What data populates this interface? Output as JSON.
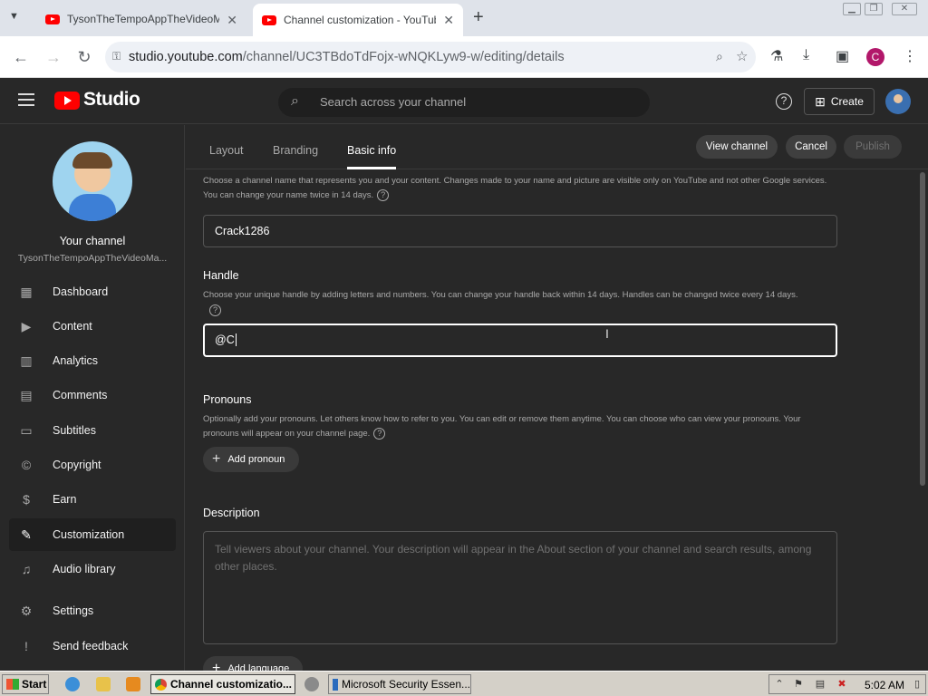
{
  "browser": {
    "tabs": [
      {
        "title": "TysonTheTempoAppTheVideoMake",
        "active": false
      },
      {
        "title": "Channel customization - YouTube S",
        "active": true
      }
    ],
    "new_tab": "+",
    "url_host": "studio.youtube.com",
    "url_path": "/channel/UC3TBdoTdFojx-wNQKLyw9-w/editing/details",
    "profile_initial": "C"
  },
  "studio": {
    "logo_text": "Studio",
    "search_placeholder": "Search across your channel",
    "create_label": "Create"
  },
  "sidebar": {
    "your_channel": "Your channel",
    "channel_name": "TysonTheTempoAppTheVideoMa...",
    "items": [
      {
        "label": "Dashboard",
        "icon": "dashboard-icon"
      },
      {
        "label": "Content",
        "icon": "content-icon"
      },
      {
        "label": "Analytics",
        "icon": "analytics-icon"
      },
      {
        "label": "Comments",
        "icon": "comments-icon"
      },
      {
        "label": "Subtitles",
        "icon": "subtitles-icon"
      },
      {
        "label": "Copyright",
        "icon": "copyright-icon"
      },
      {
        "label": "Earn",
        "icon": "earn-icon"
      },
      {
        "label": "Customization",
        "icon": "customization-icon",
        "active": true
      },
      {
        "label": "Audio library",
        "icon": "audio-library-icon"
      },
      {
        "label": "Settings",
        "icon": "settings-icon"
      },
      {
        "label": "Send feedback",
        "icon": "feedback-icon"
      }
    ]
  },
  "main": {
    "tabs": [
      {
        "label": "Layout"
      },
      {
        "label": "Branding"
      },
      {
        "label": "Basic info",
        "active": true
      }
    ],
    "view_channel": "View channel",
    "cancel": "Cancel",
    "publish": "Publish",
    "name_desc": "Choose a channel name that represents you and your content. Changes made to your name and picture are visible only on YouTube and not other Google services. You can change your name twice in 14 days.",
    "name_value": "Crack1286",
    "handle_label": "Handle",
    "handle_desc": "Choose your unique handle by adding letters and numbers. You can change your handle back within 14 days. Handles can be changed twice every 14 days.",
    "handle_value": "@C",
    "pronouns_label": "Pronouns",
    "pronouns_desc": "Optionally add your pronouns. Let others know how to refer to you. You can edit or remove them anytime. You can choose who can view your pronouns. Your pronouns will appear on your channel page.",
    "add_pronoun": "Add pronoun",
    "description_label": "Description",
    "description_placeholder": "Tell viewers about your channel. Your description will appear in the About section of your channel and search results, among other places.",
    "add_language": "Add language"
  },
  "taskbar": {
    "start": "Start",
    "items": [
      {
        "label": "Channel customizatio...",
        "active": true
      },
      {
        "label": "Microsoft Security Essen...",
        "active": false
      }
    ],
    "clock": "5:02 AM"
  },
  "colors": {
    "youtube_red": "#ff0000",
    "studio_bg": "#282828",
    "profile": "#b2176a"
  }
}
